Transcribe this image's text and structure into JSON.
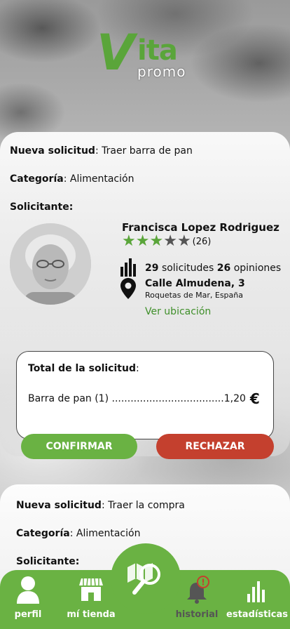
{
  "brand": {
    "logo_big": "Vita",
    "logo_small": "promo"
  },
  "request1": {
    "title_label": "Nueva solicitud",
    "title_value": ": Traer barra de pan",
    "category_label": "Categoría",
    "category_value": ": Alimentación",
    "requester_label": "Solicitante:",
    "requester": {
      "name": "Francisca Lopez Rodriguez",
      "rating": 3,
      "rating_max": 5,
      "reviews": "(26)",
      "requests_count": "29",
      "requests_label": "solicitudes",
      "opinions_count": "26",
      "opinions_label": "opiniones",
      "address": "Calle Almudena, 3",
      "city": "Roquetas de Mar, España",
      "location_link": "Ver ubicación"
    },
    "total": {
      "title_label": "Total de la solicitud",
      "title_suffix": ":",
      "item": "Barra de pan (1) ....................................1,20",
      "currency": "€"
    },
    "confirm_label": "CONFIRMAR",
    "reject_label": "RECHAZAR"
  },
  "request2": {
    "title_label": "Nueva solicitud",
    "title_value": ": Traer la compra",
    "category_label": "Categoría",
    "category_value": ": Alimentación",
    "requester_label": "Solicitante:"
  },
  "nav": {
    "profile": "perfil",
    "store": "mí tienda",
    "history": "historial",
    "stats": "estadísticas",
    "center_icon": "map-search-icon",
    "history_alert": "!"
  },
  "colors": {
    "green": "#6ab243",
    "red": "#c4402e",
    "link_green": "#3f8f2a"
  }
}
